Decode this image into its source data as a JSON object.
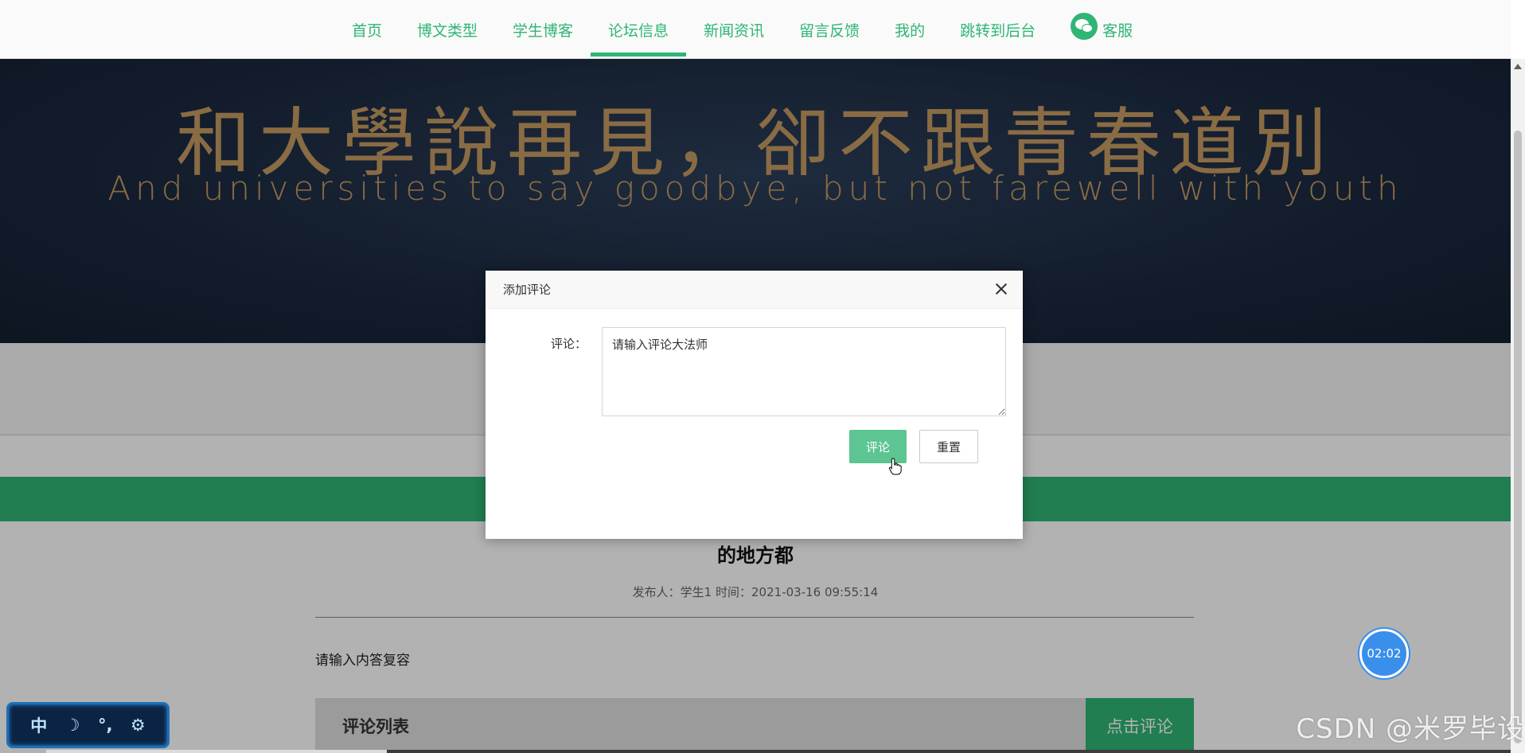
{
  "nav": {
    "items": [
      {
        "label": "首页"
      },
      {
        "label": "博文类型"
      },
      {
        "label": "学生博客"
      },
      {
        "label": "论坛信息"
      },
      {
        "label": "新闻资讯"
      },
      {
        "label": "留言反馈"
      },
      {
        "label": "我的"
      },
      {
        "label": "跳转到后台"
      }
    ],
    "active_item": "论坛信息",
    "service_label": "客服"
  },
  "banner": {
    "title_cn": "和大學說再見，卻不跟青春道別",
    "title_en": "And universities to say goodbye, but not farewell with youth"
  },
  "post": {
    "title": "的地方都",
    "author_label": "发布人：",
    "author": "学生1",
    "time_label": "时间：",
    "time": "2021-03-16 09:55:14",
    "body": "请输入内答复容"
  },
  "comments": {
    "list_title": "评论列表",
    "add_button": "点击评论"
  },
  "dialog": {
    "title": "添加评论",
    "field_label": "评论：",
    "textarea_value": "请输入评论大法师",
    "submit_label": "评论",
    "reset_label": "重置"
  },
  "timer": {
    "value": "02:02"
  },
  "ime": {
    "mode": "中",
    "moon": "☽",
    "punct": "°,",
    "settings": "⚙"
  },
  "watermark": "CSDN @米罗毕设",
  "colors": {
    "accent": "#2fb574",
    "accent_light": "#5cc592",
    "banner_bg": "#1c2a40",
    "banner_text": "#c49a62",
    "timer": "#3a8fea"
  }
}
